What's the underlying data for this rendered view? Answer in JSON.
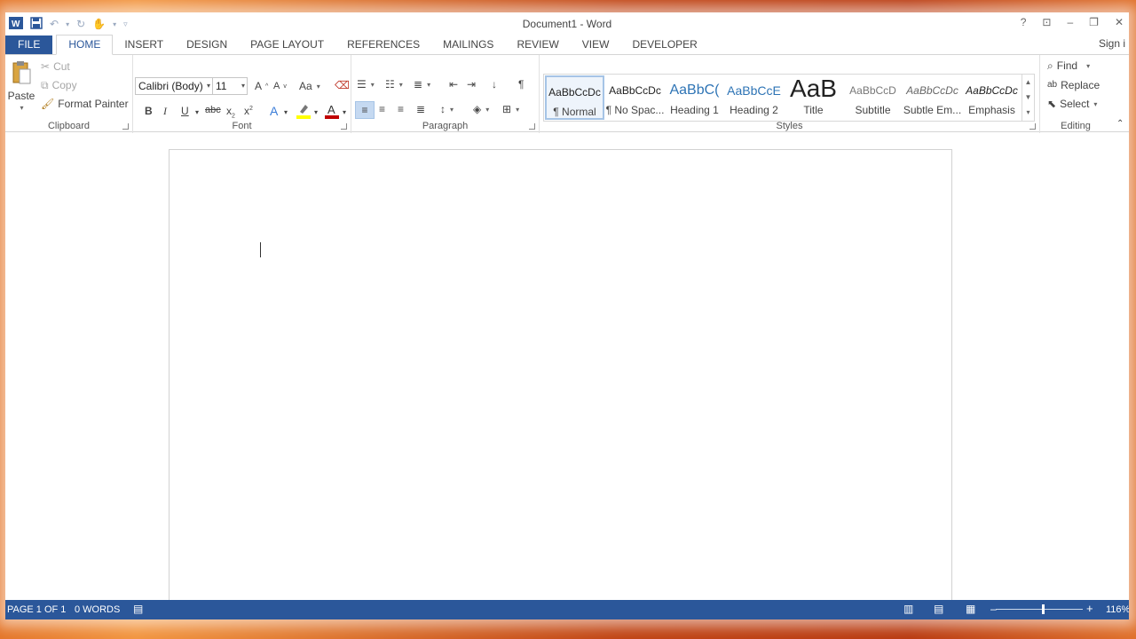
{
  "titlebar": {
    "title": "Document1 - Word",
    "help_icon": "?",
    "ribbon_display_icon": "⊡",
    "minimize_icon": "–",
    "restore_icon": "❐",
    "close_icon": "✕"
  },
  "tabs": [
    {
      "label": "FILE"
    },
    {
      "label": "HOME"
    },
    {
      "label": "INSERT"
    },
    {
      "label": "DESIGN"
    },
    {
      "label": "PAGE LAYOUT"
    },
    {
      "label": "REFERENCES"
    },
    {
      "label": "MAILINGS"
    },
    {
      "label": "REVIEW"
    },
    {
      "label": "VIEW"
    },
    {
      "label": "DEVELOPER"
    }
  ],
  "signin": "Sign i",
  "clipboard": {
    "group_label": "Clipboard",
    "paste": "Paste",
    "cut": "Cut",
    "copy": "Copy",
    "format_painter": "Format Painter"
  },
  "font": {
    "group_label": "Font",
    "font_name": "Calibri (Body)",
    "font_size": "11",
    "change_case": "Aa"
  },
  "paragraph": {
    "group_label": "Paragraph"
  },
  "styles": {
    "group_label": "Styles",
    "items": [
      {
        "preview": "AaBbCcDc",
        "name": "¶ Normal"
      },
      {
        "preview": "AaBbCcDc",
        "name": "¶ No Spac..."
      },
      {
        "preview": "AaBbC(",
        "name": "Heading 1"
      },
      {
        "preview": "AaBbCcE",
        "name": "Heading 2"
      },
      {
        "preview": "AaB",
        "name": "Title"
      },
      {
        "preview": "AaBbCcD",
        "name": "Subtitle"
      },
      {
        "preview": "AaBbCcDc",
        "name": "Subtle Em..."
      },
      {
        "preview": "AaBbCcDc",
        "name": "Emphasis"
      }
    ]
  },
  "editing": {
    "group_label": "Editing",
    "find": "Find",
    "replace": "Replace",
    "select": "Select"
  },
  "status": {
    "page": "PAGE 1 OF 1",
    "words": "0 WORDS",
    "zoom": "116%",
    "zoom_minus": "–",
    "zoom_plus": "+"
  },
  "colors": {
    "accent": "#2b579a",
    "highlight": "#ffff00",
    "font_color": "#c00000"
  }
}
